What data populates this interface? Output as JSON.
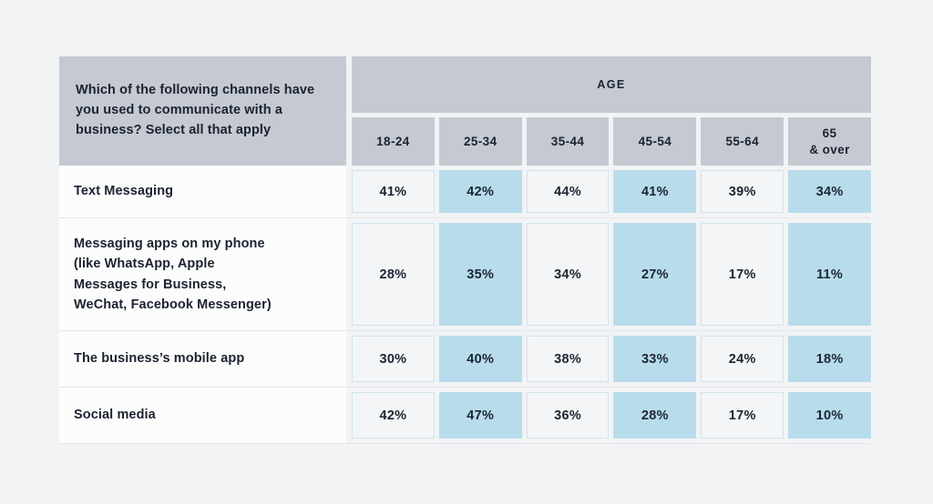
{
  "page": {
    "background": "#f2f3f5"
  },
  "colors": {
    "header_gray": "#c5c9d2",
    "cell_blue": "#b8dcec",
    "cell_light": "#f4f5f6",
    "cell_border": "#cfe5f0",
    "text_dark": "#1b2330"
  },
  "chart_data": {
    "type": "table",
    "title": "Which of the following channels have you used to communicate with a business? Select all that apply",
    "group_header": "AGE",
    "categories": [
      "18-24",
      "25-34",
      "35-44",
      "45-54",
      "55-64",
      "65\n& over"
    ],
    "xlabel": "Age",
    "ylabel": "",
    "series": [
      {
        "name": "Text Messaging",
        "values": [
          "41%",
          "42%",
          "44%",
          "41%",
          "39%",
          "34%"
        ]
      },
      {
        "name": "Messaging apps on my phone\n(like WhatsApp, Apple\nMessages for Business,\nWeChat, Facebook Messenger)",
        "values": [
          "28%",
          "35%",
          "34%",
          "27%",
          "17%",
          "11%"
        ]
      },
      {
        "name": "The business’s mobile app",
        "values": [
          "30%",
          "40%",
          "38%",
          "33%",
          "24%",
          "18%"
        ]
      },
      {
        "name": "Social media",
        "values": [
          "42%",
          "47%",
          "36%",
          "28%",
          "17%",
          "10%"
        ]
      }
    ],
    "column_shading": [
      "light",
      "blue",
      "light",
      "blue",
      "light",
      "blue"
    ]
  }
}
